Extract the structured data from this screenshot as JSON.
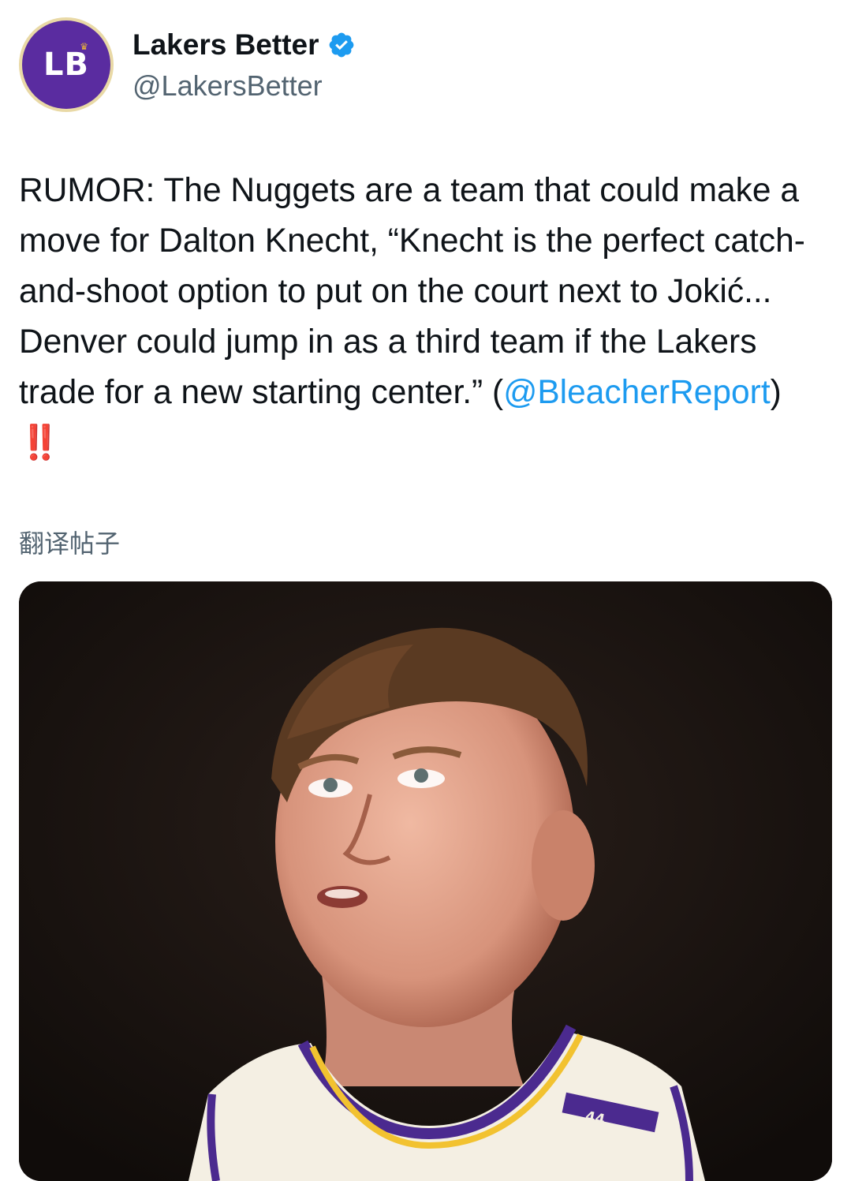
{
  "author": {
    "avatar_initials": "LB",
    "display_name": "Lakers Better",
    "handle": "@LakersBetter",
    "verified": true
  },
  "tweet": {
    "text_before_mention": "RUMOR: The Nuggets are a team that could make a move for Dalton Knecht, “Knecht is the perfect catch-and-shoot option to put on the court next to Jokić... Denver could jump in as a third team if the Lakers trade for a new starting center.” (",
    "mention": "@BleacherReport",
    "text_after_mention": ") ",
    "emoji": "‼️"
  },
  "translate_label": "翻译帖子",
  "media": {
    "jersey_number": "44"
  },
  "colors": {
    "link": "#1d9bf0",
    "avatar_bg": "#5a2ca0",
    "verified": "#1d9bf0"
  },
  "icons": [
    "verified-badge-icon"
  ]
}
